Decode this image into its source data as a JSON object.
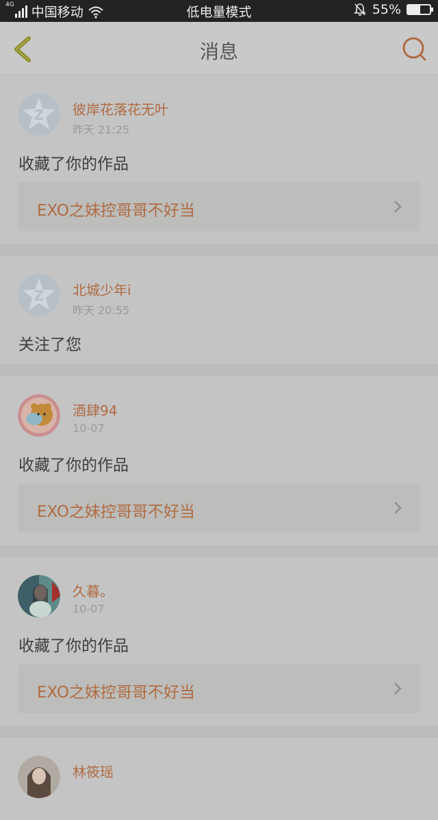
{
  "status_bar": {
    "network_tag": "4G",
    "carrier": "中国移动",
    "mode": "低电量模式",
    "battery": "55%",
    "battery_level": 0.55
  },
  "header": {
    "title": "消息",
    "back_icon": "chevron-left-icon",
    "search_icon": "search-icon"
  },
  "colors": {
    "accent": "#b06b43",
    "back": "#8a8a2a"
  },
  "messages": [
    {
      "user": "彼岸花落花无叶",
      "time": "昨天 21:25",
      "action": "收藏了你的作品",
      "work": "EXO之妹控哥哥不好当",
      "avatar": "default-qq-avatar"
    },
    {
      "user": "北城少年i",
      "time": "昨天 20:55",
      "action": "关注了您",
      "avatar": "default-qq-avatar"
    },
    {
      "user": "酒肆94",
      "time": "10-07",
      "action": "收藏了你的作品",
      "work": "EXO之妹控哥哥不好当",
      "avatar": "cartoon-bear-avatar"
    },
    {
      "user": "久暮。",
      "time": "10-07",
      "action": "收藏了你的作品",
      "work": "EXO之妹控哥哥不好当",
      "avatar": "photo-avatar"
    },
    {
      "user": "林筱瑶",
      "avatar": "photo-avatar"
    }
  ]
}
